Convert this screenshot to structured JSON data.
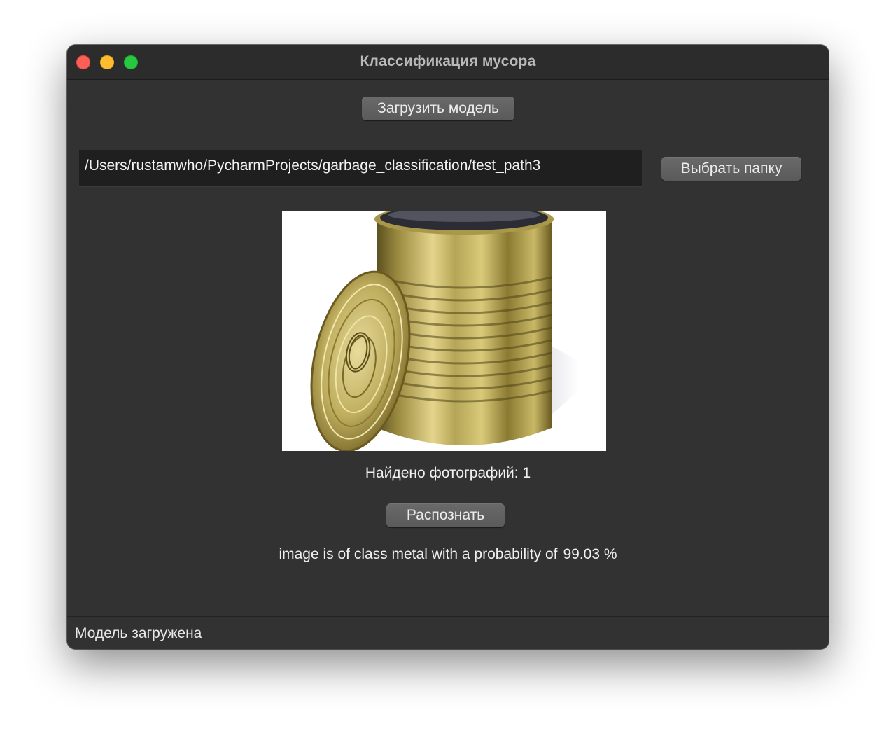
{
  "window": {
    "title": "Классификация мусора"
  },
  "toolbar": {
    "load_model_label": "Загрузить модель",
    "choose_folder_label": "Выбрать папку",
    "recognize_label": "Распознать"
  },
  "folder_path": {
    "value": "/Users/rustamwho/PycharmProjects/garbage_classification/test_path3"
  },
  "photo": {
    "subject": "tin-can-with-lid"
  },
  "found": {
    "text": "Найдено фотографий: 1"
  },
  "result": {
    "text": "image is of class metal with a probability of",
    "value": "99.03 %"
  },
  "status": {
    "text": "Модель загружена"
  },
  "colors": {
    "window_bg": "#323232",
    "button_bg": "#5f5f5f",
    "close": "#fe5f57",
    "minimize": "#febc2e",
    "maximize": "#28c840"
  }
}
